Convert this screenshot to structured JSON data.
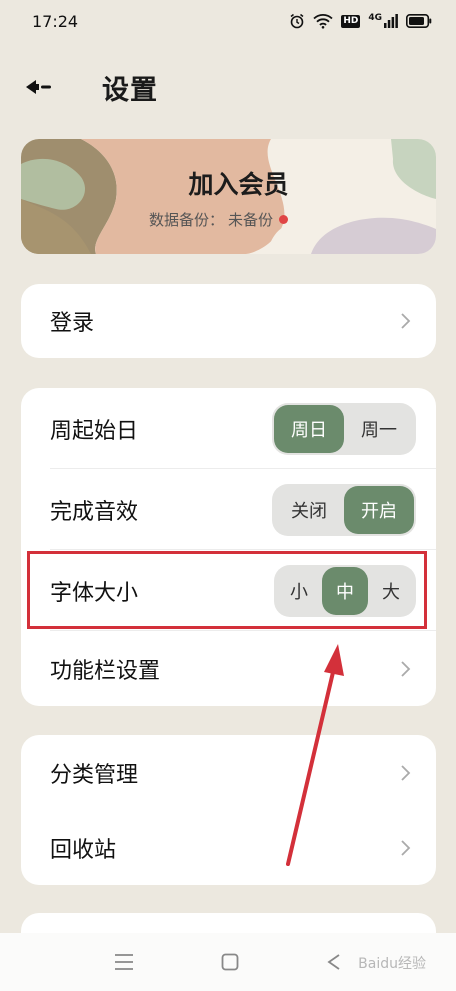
{
  "status_bar": {
    "time": "17:24",
    "hd": "HD",
    "network": "4G"
  },
  "header": {
    "title": "设置"
  },
  "banner": {
    "title": "加入会员",
    "backup_label": "数据备份：",
    "backup_status": "未备份"
  },
  "login": {
    "label": "登录"
  },
  "settings": {
    "week_start": {
      "label": "周起始日",
      "options": [
        "周日",
        "周一"
      ],
      "selected": "周日"
    },
    "sound": {
      "label": "完成音效",
      "options": [
        "关闭",
        "开启"
      ],
      "selected": "开启"
    },
    "font_size": {
      "label": "字体大小",
      "options": [
        "小",
        "中",
        "大"
      ],
      "selected": "中"
    },
    "toolbar": {
      "label": "功能栏设置"
    }
  },
  "manage": {
    "category": {
      "label": "分类管理"
    },
    "trash": {
      "label": "回收站"
    }
  },
  "watermark": "Baidu经验",
  "colors": {
    "accent": "#6b8b6c",
    "background": "#ece8df",
    "annotation": "#d3303a"
  }
}
